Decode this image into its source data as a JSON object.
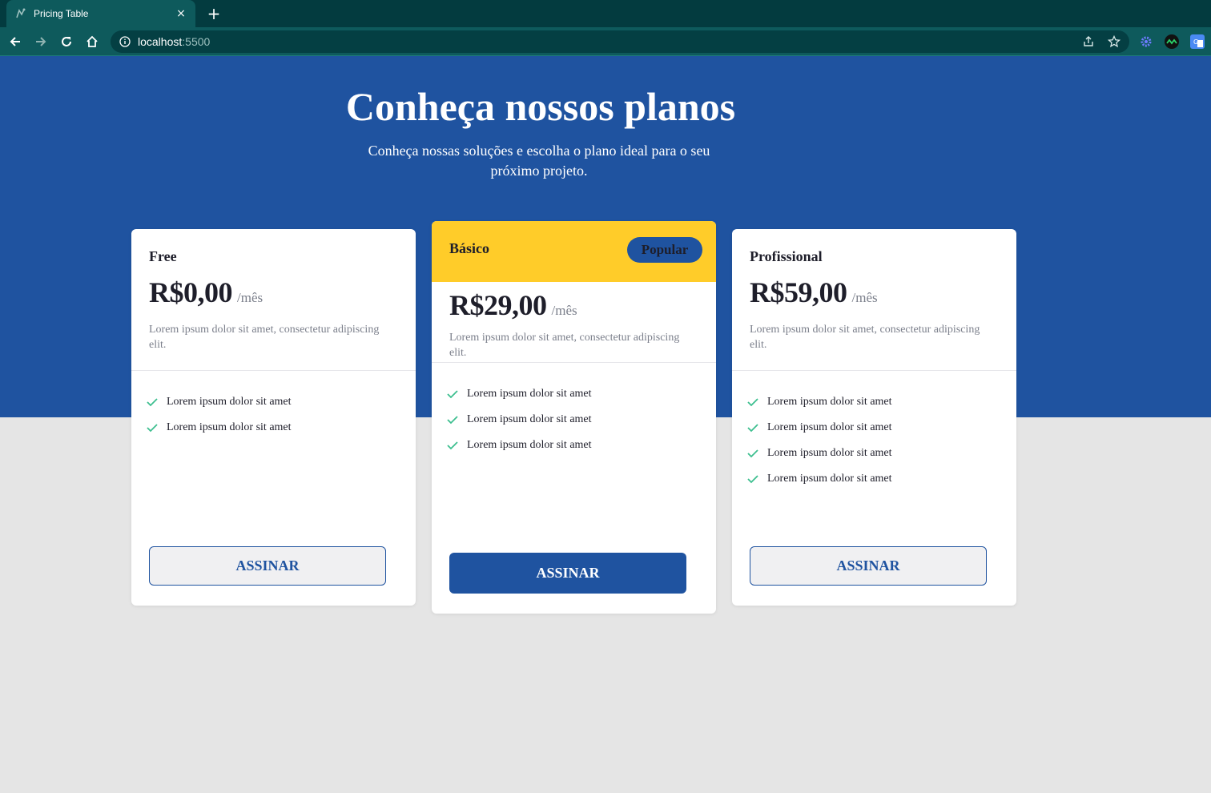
{
  "browser": {
    "tab_title": "Pricing Table",
    "tab_close": "×",
    "new_tab": "+",
    "url_host": "localhost",
    "url_port": ":5500"
  },
  "hero": {
    "title": "Conheça nossos planos",
    "subtitle": "Conheça nossas soluções e escolha o plano ideal para o seu próximo projeto."
  },
  "plans": [
    {
      "name": "Free",
      "price": "R$0,00",
      "period": "/mês",
      "description": "Lorem ipsum dolor sit amet, consectetur adipiscing elit.",
      "features": [
        "Lorem ipsum dolor sit amet",
        "Lorem ipsum dolor sit amet"
      ],
      "button": "ASSINAR"
    },
    {
      "name": "Básico",
      "badge": "Popular",
      "price": "R$29,00",
      "period": "/mês",
      "description": "Lorem ipsum dolor sit amet, consectetur adipiscing elit.",
      "features": [
        "Lorem ipsum dolor sit amet",
        "Lorem ipsum dolor sit amet",
        "Lorem ipsum dolor sit amet"
      ],
      "button": "ASSINAR"
    },
    {
      "name": "Profissional",
      "price": "R$59,00",
      "period": "/mês",
      "description": "Lorem ipsum dolor sit amet, consectetur adipiscing elit.",
      "features": [
        "Lorem ipsum dolor sit amet",
        "Lorem ipsum dolor sit amet",
        "Lorem ipsum dolor sit amet",
        "Lorem ipsum dolor sit amet"
      ],
      "button": "ASSINAR"
    }
  ],
  "colors": {
    "hero_bg": "#1f53a0",
    "page_bg": "#e5e5e5",
    "popular_header": "#ffcc29",
    "check": "#3dbf8f",
    "primary": "#1f53a0"
  },
  "icons": [
    "back-arrow-icon",
    "forward-arrow-icon",
    "reload-icon",
    "home-icon",
    "info-icon",
    "share-icon",
    "star-icon",
    "check-icon"
  ]
}
